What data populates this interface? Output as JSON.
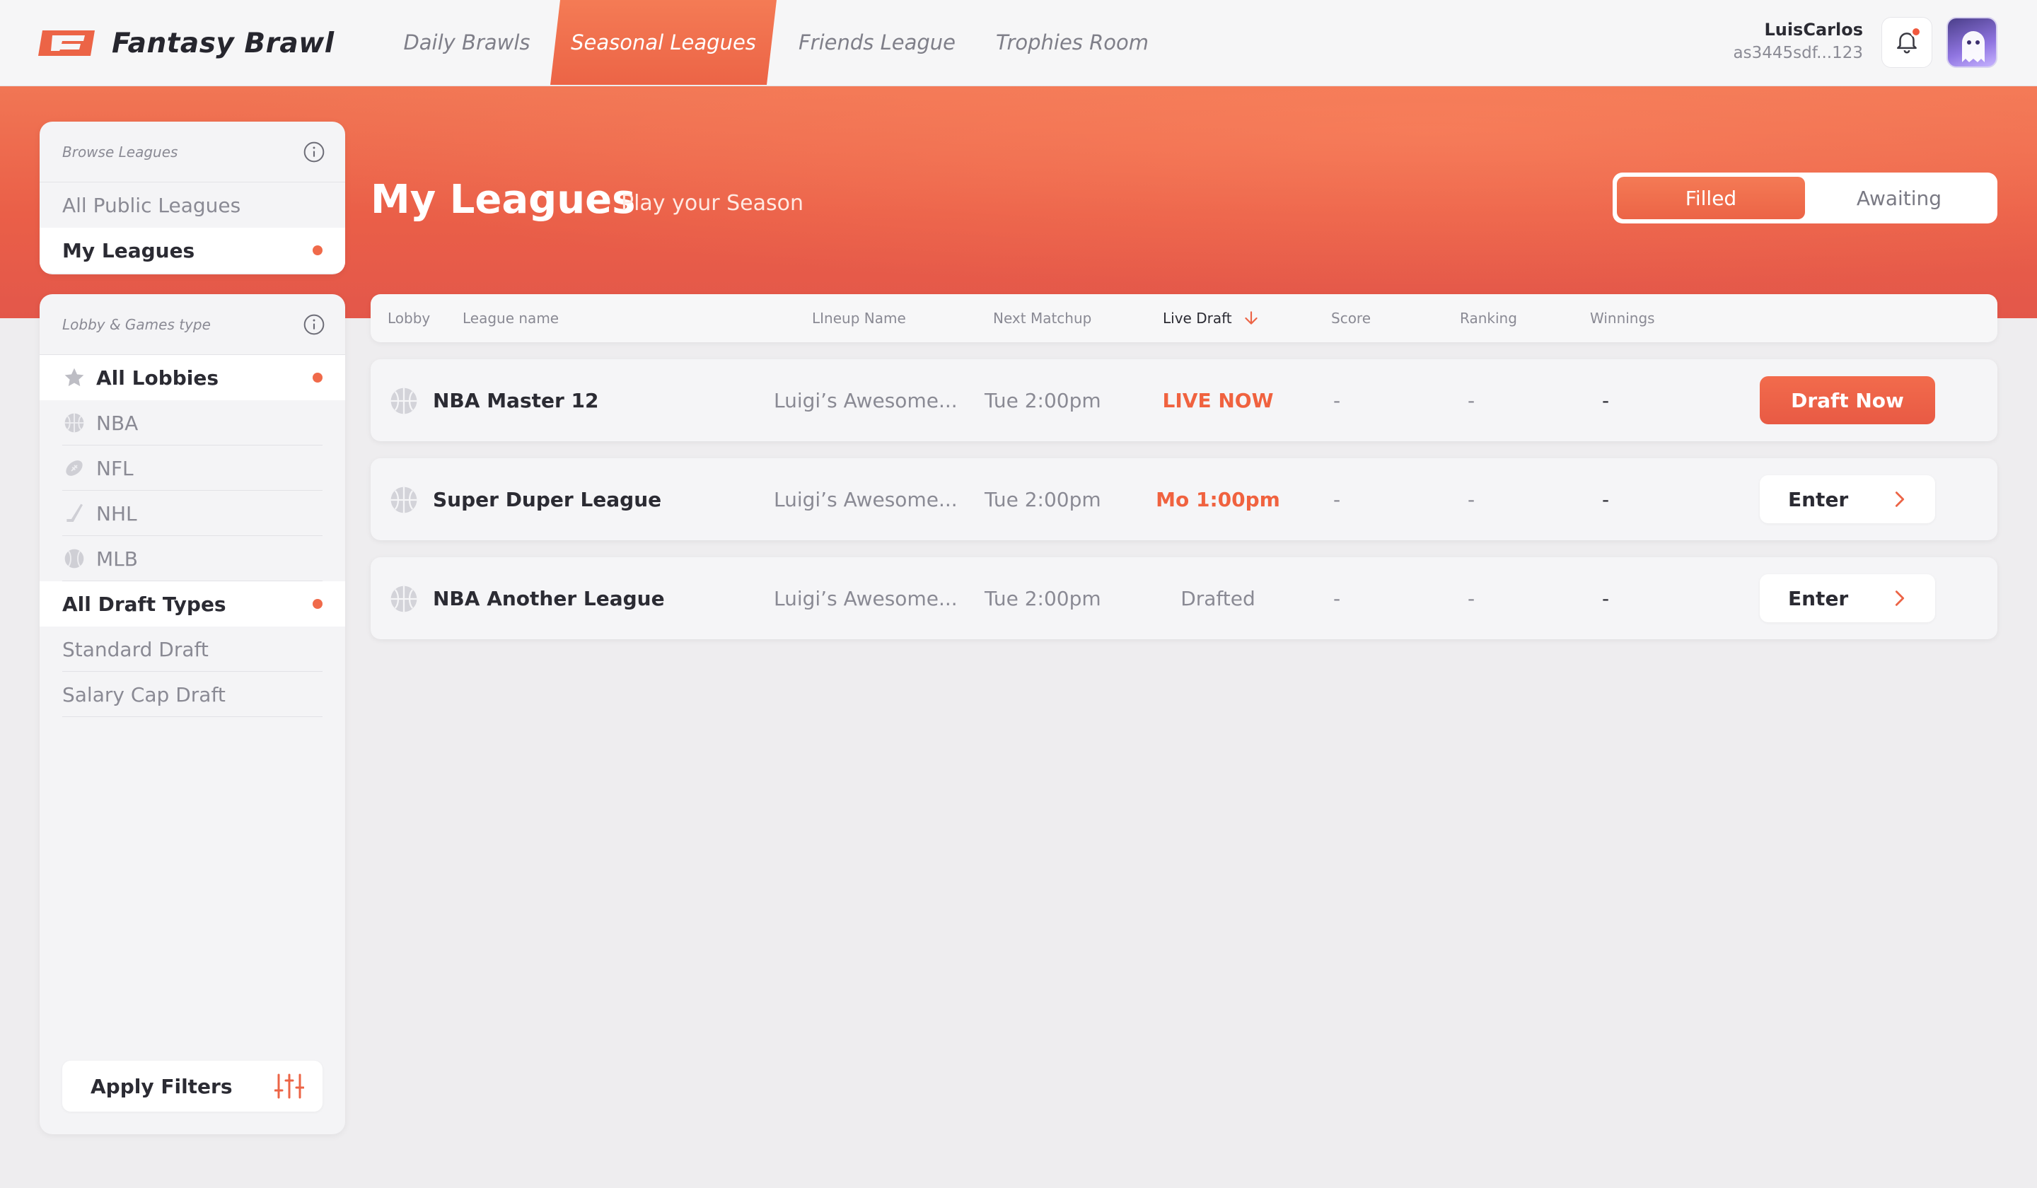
{
  "app": {
    "name": "Fantasy Brawl",
    "logo_icon": "fantasy-brawl-logo",
    "accent_color": "#EC6446"
  },
  "nav": {
    "tabs": [
      {
        "label": "Daily Brawls",
        "active": false
      },
      {
        "label": "Seasonal Leagues",
        "active": true
      },
      {
        "label": "Friends League",
        "active": false
      },
      {
        "label": "Trophies Room",
        "active": false
      }
    ]
  },
  "user": {
    "name": "LuisCarlos",
    "id": "as3445sdf...123",
    "notification_icon": "bell-icon",
    "has_notification": true,
    "avatar_icon": "ghost-avatar"
  },
  "hero": {
    "title": "My Leagues",
    "subtitle": "Play your Season",
    "toggle": {
      "selected": "Filled",
      "options": [
        "Filled",
        "Awaiting"
      ]
    }
  },
  "browse_panel": {
    "heading": "Browse Leagues",
    "info_icon": "info-icon",
    "items": [
      {
        "label": "All Public Leagues",
        "selected": false
      },
      {
        "label": "My Leagues",
        "selected": true
      }
    ]
  },
  "filter_panel": {
    "heading": "Lobby & Games type",
    "info_icon": "info-icon",
    "lobbies": [
      {
        "label": "All Lobbies",
        "icon": "star-icon",
        "selected": true
      },
      {
        "label": "NBA",
        "icon": "basketball-icon",
        "selected": false
      },
      {
        "label": "NFL",
        "icon": "football-icon",
        "selected": false
      },
      {
        "label": "NHL",
        "icon": "hockey-stick-icon",
        "selected": false
      },
      {
        "label": "MLB",
        "icon": "baseball-icon",
        "selected": false
      }
    ],
    "draft_types": [
      {
        "label": "All Draft Types",
        "selected": true
      },
      {
        "label": "Standard Draft",
        "selected": false
      },
      {
        "label": "Salary Cap Draft",
        "selected": false
      }
    ],
    "apply_label": "Apply Filters",
    "apply_icon": "sliders-icon"
  },
  "table": {
    "columns": [
      "Lobby",
      "League name",
      "LIneup Name",
      "Next Matchup",
      "Live Draft",
      "Score",
      "Ranking",
      "Winnings"
    ],
    "sorted_column": "Live Draft",
    "sort_icon": "arrow-down-icon",
    "rows": [
      {
        "lobby_icon": "basketball-icon",
        "league": "NBA Master 12",
        "lineup": "Luigi’s Awesome...",
        "matchup": "Tue 2:00pm",
        "live_draft": "LIVE NOW",
        "live_draft_style": "live",
        "score": "-",
        "ranking": "-",
        "winnings": "-",
        "action": "Draft Now",
        "action_style": "primary"
      },
      {
        "lobby_icon": "basketball-icon",
        "league": "Super Duper League",
        "lineup": "Luigi’s Awesome...",
        "matchup": "Tue 2:00pm",
        "live_draft": "Mo 1:00pm",
        "live_draft_style": "live",
        "score": "-",
        "ranking": "-",
        "winnings": "-",
        "action": "Enter",
        "action_style": "secondary"
      },
      {
        "lobby_icon": "basketball-icon",
        "league": "NBA Another League",
        "lineup": "Luigi’s Awesome...",
        "matchup": "Tue 2:00pm",
        "live_draft": "Drafted",
        "live_draft_style": "muted",
        "score": "-",
        "ranking": "-",
        "winnings": "-",
        "action": "Enter",
        "action_style": "secondary"
      }
    ]
  }
}
